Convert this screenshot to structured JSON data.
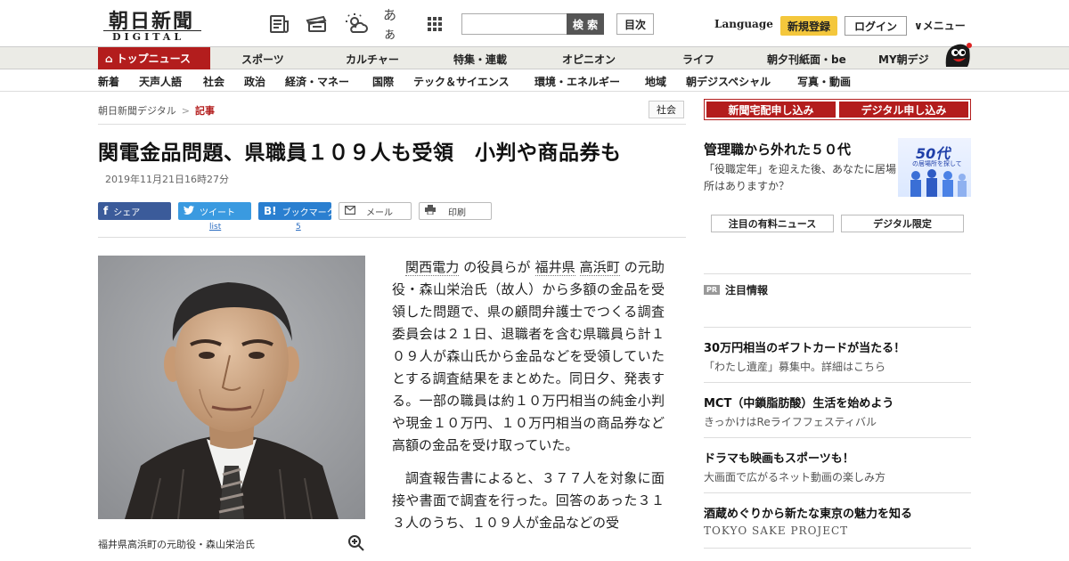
{
  "header": {
    "logo_jp": "朝日新聞",
    "logo_en": "DIGITAL",
    "kana_icon": "あぁ",
    "search_placeholder": "",
    "search_label": "検 索",
    "toc_label": "目次",
    "language_label": "Language",
    "register_label": "新規登録",
    "login_label": "ログイン",
    "menu_label": "∨メニュー"
  },
  "nav1": {
    "top_news": "トップニュース",
    "items": [
      "スポーツ",
      "カルチャー",
      "特集・連載",
      "オピニオン",
      "ライフ",
      "朝夕刊紙面・be",
      "MY朝デジ"
    ]
  },
  "nav2": {
    "items": [
      "新着",
      "天声人語",
      "社会",
      "政治",
      "経済・マネー",
      "国際",
      "テック＆サイエンス",
      "環境・エネルギー",
      "地域",
      "朝デジスペシャル",
      "写真・動画"
    ]
  },
  "breadcrumb": {
    "home": "朝日新聞デジタル",
    "separator": ">",
    "current": "記事",
    "category": "社会"
  },
  "article": {
    "headline": "関電金品問題、県職員１０９人も受領　小判や商品券も",
    "date": "2019年11月21日16時27分",
    "share": {
      "facebook": "シェア",
      "twitter": "ツイート",
      "twitter_sub": "list",
      "hatena": "ブックマーク",
      "hatena_icon": "B!",
      "hatena_count": "5",
      "mail": "メール",
      "print": "印刷"
    },
    "photo_caption": "福井県高浜町の元助役・森山栄治氏",
    "p1_link1": "関西電力",
    "p1_t1": "の役員らが",
    "p1_link2": "福井県",
    "p1_link3": "高浜町",
    "p1_t2": "の元助役・森山栄治氏（故人）から多額の金品を受領した問題で、県の顧問弁護士でつくる調査委員会は２１日、退職者を含む県職員ら計１０９人が森山氏から金品などを受領していたとする調査結果をまとめた。同日夕、発表する。一部の職員は約１０万円相当の純金小判や現金１０万円、１０万円相当の商品券など高額の金品を受け取っていた。",
    "p2": "調査報告書によると、３７７人を対象に面接や書面で調査を行った。回答のあった３１３人のうち、１０９人が金品などの受"
  },
  "sidebar": {
    "subscribe_paper": "新聞宅配申し込み",
    "subscribe_digital": "デジタル申し込み",
    "promo_title": "管理職から外れた５０代",
    "promo_text": "「役職定年」を迎えた後、あなたに居場所はありますか？",
    "promo_img_big": "50代",
    "promo_img_small": "の居場所を探して",
    "tab_premium": "注目の有料ニュース",
    "tab_digital": "デジタル限定",
    "pr_badge": "PR",
    "pr_head": "注目情報",
    "ads": [
      {
        "title": "30万円相当のギフトカードが当たる！",
        "text": "「わたし遺産」募集中。詳細はこちら"
      },
      {
        "title": "MCT（中鎖脂肪酸）生活を始めよう",
        "text": "きっかけはReライフフェスティバル"
      },
      {
        "title": "ドラマも映画もスポーツも！",
        "text": "大画面で広がるネット動画の楽しみ方"
      },
      {
        "title": "酒蔵めぐりから新たな東京の魅力を知る",
        "text": "TOKYO SAKE PROJECT"
      }
    ]
  },
  "colors": {
    "brand_red": "#b31d1d",
    "register_yellow": "#f4c73c",
    "facebook": "#3b5b9a",
    "twitter": "#3a9ae0",
    "hatena": "#2a7fd0"
  }
}
